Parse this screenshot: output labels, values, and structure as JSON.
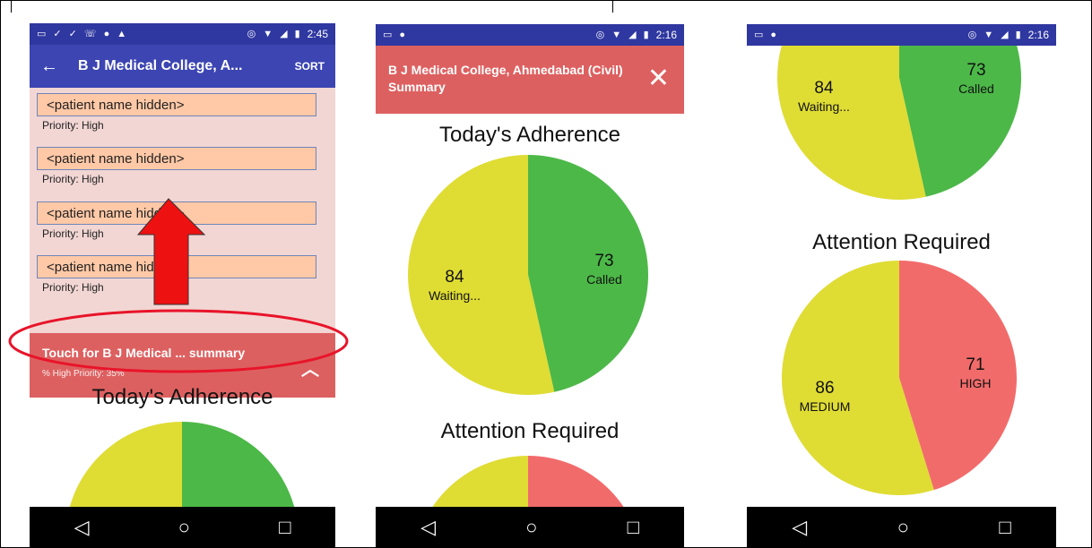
{
  "colors": {
    "called": "#4cb848",
    "waiting": "#dfdc34",
    "high": "#f26b6b",
    "medium": "#dfdc34",
    "appbar_blue": "#3c45b2",
    "header_red": "#dd6060"
  },
  "phone1": {
    "status_time": "2:45",
    "title": "B J Medical College, A...",
    "sort_label": "SORT",
    "patients": [
      {
        "name": "<patient name hidden>",
        "priority": "Priority: High"
      },
      {
        "name": "<patient name hidden>",
        "priority": "Priority: High"
      },
      {
        "name": "<patient name hidden>",
        "priority": "Priority: High"
      },
      {
        "name": "<patient name hidden>",
        "priority": "Priority: High"
      }
    ],
    "summary_bar": {
      "title": "Touch for B J Medical ... summary",
      "subtitle": "% High Priority: 35%"
    },
    "section_title": "Today's Adherence"
  },
  "phone2": {
    "status_time": "2:16",
    "header_title": "B J Medical College, Ahmedabad (Civil) Summary",
    "adherence_title": "Today's Adherence",
    "attention_title": "Attention Required"
  },
  "phone3": {
    "status_time": "2:16",
    "attention_title": "Attention Required"
  },
  "chart_data": [
    {
      "type": "pie",
      "title": "Today's Adherence",
      "labels": [
        "Called",
        "Waiting..."
      ],
      "values": [
        73,
        84
      ]
    },
    {
      "type": "pie",
      "title": "Attention Required",
      "labels": [
        "HIGH",
        "MEDIUM"
      ],
      "values": [
        71,
        86
      ]
    }
  ]
}
